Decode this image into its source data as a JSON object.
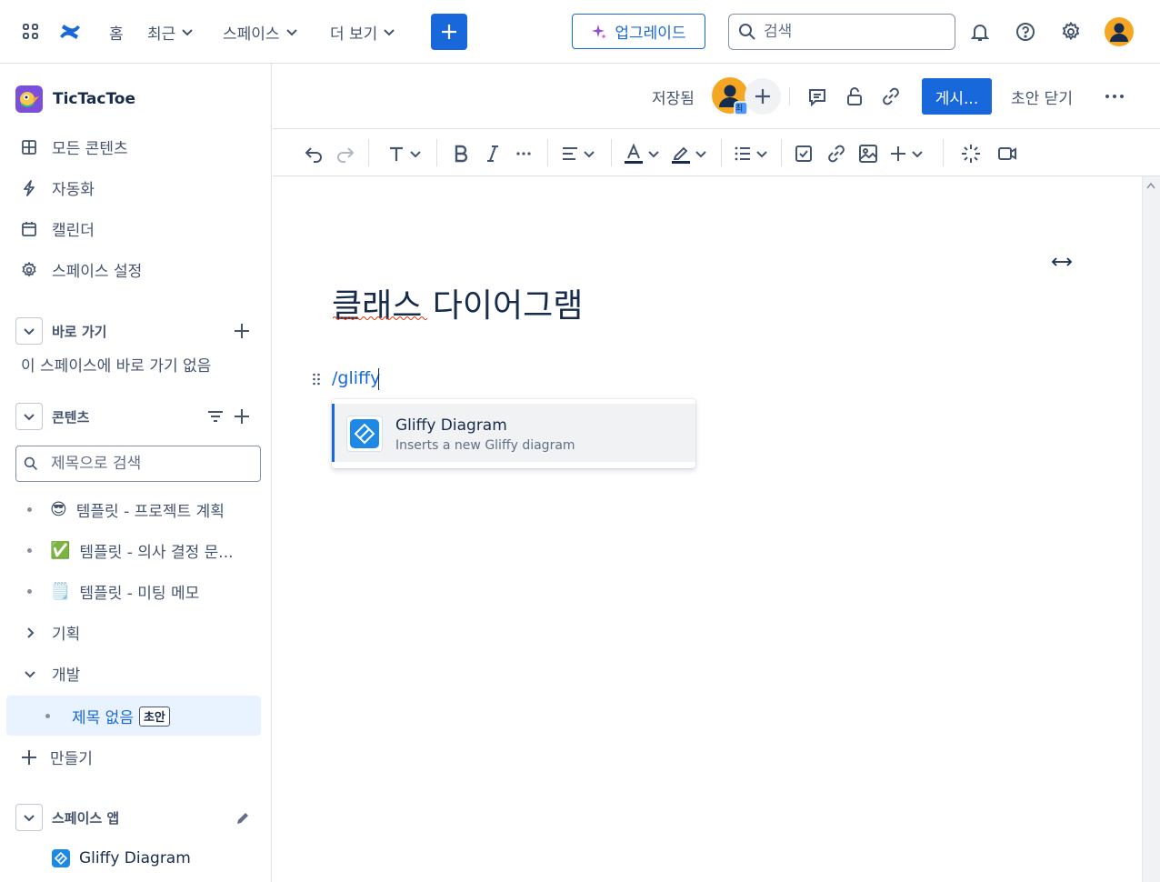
{
  "topnav": {
    "home": "홈",
    "recent": "최근",
    "spaces": "스페이스",
    "more": "더 보기",
    "upgrade": "업그레이드",
    "search_placeholder": "검색"
  },
  "sidebar": {
    "space_name": "TicTacToe",
    "nav": [
      "모든 콘텐츠",
      "자동화",
      "캘린더",
      "스페이스 설정"
    ],
    "shortcuts_title": "바로 가기",
    "shortcuts_empty": "이 스페이스에 바로 가기 없음",
    "content_title": "콘텐츠",
    "search_placeholder": "제목으로 검색",
    "tree": [
      {
        "emoji": "😎",
        "label": "템플릿 - 프로젝트 계획"
      },
      {
        "emoji": "✅",
        "label": "템플릿 - 의사 결정 문..."
      },
      {
        "emoji": "🗒️",
        "label": "템플릿 - 미팅 메모"
      }
    ],
    "folder_planning": "기획",
    "folder_dev": "개발",
    "selected_page": "제목 없음",
    "draft_badge": "초안",
    "create": "만들기",
    "apps_title": "스페이스 앱",
    "app_gliffy": "Gliffy Diagram"
  },
  "editor": {
    "saved": "저장됨",
    "avatar_badge": "최",
    "publish": "게시...",
    "close_draft": "초안 닫기",
    "title": "클래스 다이어그램",
    "slash_command": "/gliffy",
    "suggestion": {
      "title": "Gliffy Diagram",
      "subtitle": "Inserts a new Gliffy diagram"
    }
  },
  "colors": {
    "accent": "#1868db",
    "avatar": "#f5a623"
  }
}
